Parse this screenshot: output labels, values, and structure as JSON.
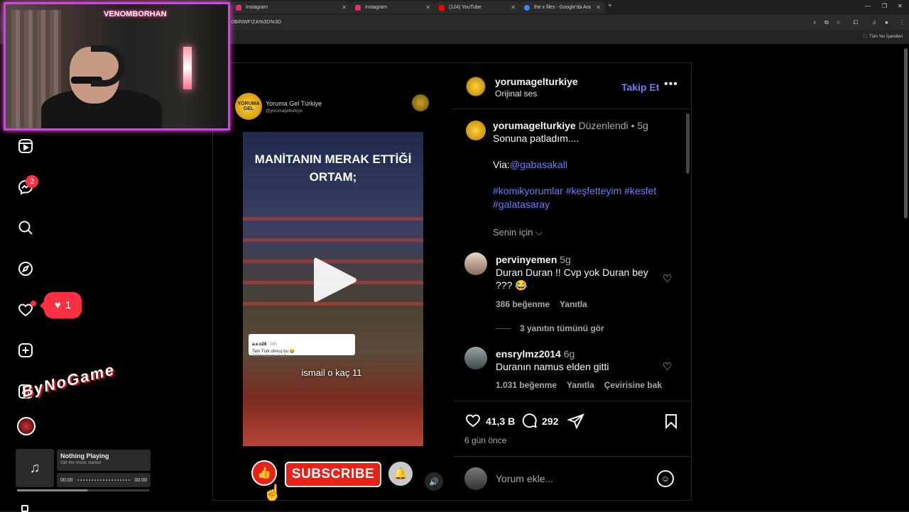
{
  "browser": {
    "tabs": [
      {
        "label": "Instagram",
        "color": "#e1306c"
      },
      {
        "label": "Instagram",
        "color": "#e1306c"
      },
      {
        "label": "(124) YouTube",
        "color": "#ff0000"
      },
      {
        "label": "the x files - Google'da Ara",
        "color": "#4285f4"
      }
    ],
    "url": "0BiNWFIZA%3D%3D",
    "bookmarks_label": "Tüm Yer İşaretleri"
  },
  "overlay": {
    "streamer_name": "VENOMBORHAN",
    "watermark": "ByNoGame",
    "music": {
      "title": "Nothing Playing",
      "subtitle": "Get the music started",
      "time_start": "00:00",
      "time_end": "00:00",
      "progress": 0.53
    }
  },
  "nav": {
    "messages_badge": "2",
    "notification_count": "1"
  },
  "video": {
    "brand_name": "Yoruma Gel Türkiye",
    "brand_handle": "@yorumagelturkiye",
    "caption": "MANİTANIN MERAK ETTİĞİ ORTAM;",
    "subtitle": "ismail o kaç 11",
    "comment_card": {
      "user": "a.e.o28",
      "time": "16h",
      "text": "Tam Türk olmuş bu 😂",
      "likes": "9.937 beğenme  Yanıtla"
    },
    "subscribe_label": "SUBSCRIBE"
  },
  "post": {
    "username": "yorumagelturkiye",
    "audio": "Orijinal ses",
    "follow_label": "Takip Et",
    "caption": {
      "edited": "Düzenlendi",
      "age": "5g",
      "line1": "Sonuna patladım....",
      "via": "Via:",
      "via_user": "@gabasakall",
      "hashtags_line1": "#komikyorumlar #keşfetteyim #kesfet",
      "hashtags_line2": "#galatasaray",
      "for_you": "Senin için"
    },
    "comments": [
      {
        "user": "pervinyemen",
        "age": "5g",
        "text_line1": "Duran Duran !! Cvp yok Duran bey",
        "text_line2": "??? 😂",
        "likes": "386 beğenme",
        "reply": "Yanıtla",
        "view_replies": "3 yanıtın tümünü gör"
      },
      {
        "user": "ensrylmz2014",
        "age": "6g",
        "text_line1": "Duranın namus elden gitti",
        "likes": "1.031 beğenme",
        "reply": "Yanıtla",
        "translate": "Çevirisine bak"
      }
    ],
    "like_count": "41,3 B",
    "comment_count": "292",
    "time_ago": "6 gün önce",
    "comment_placeholder": "Yorum ekle..."
  }
}
